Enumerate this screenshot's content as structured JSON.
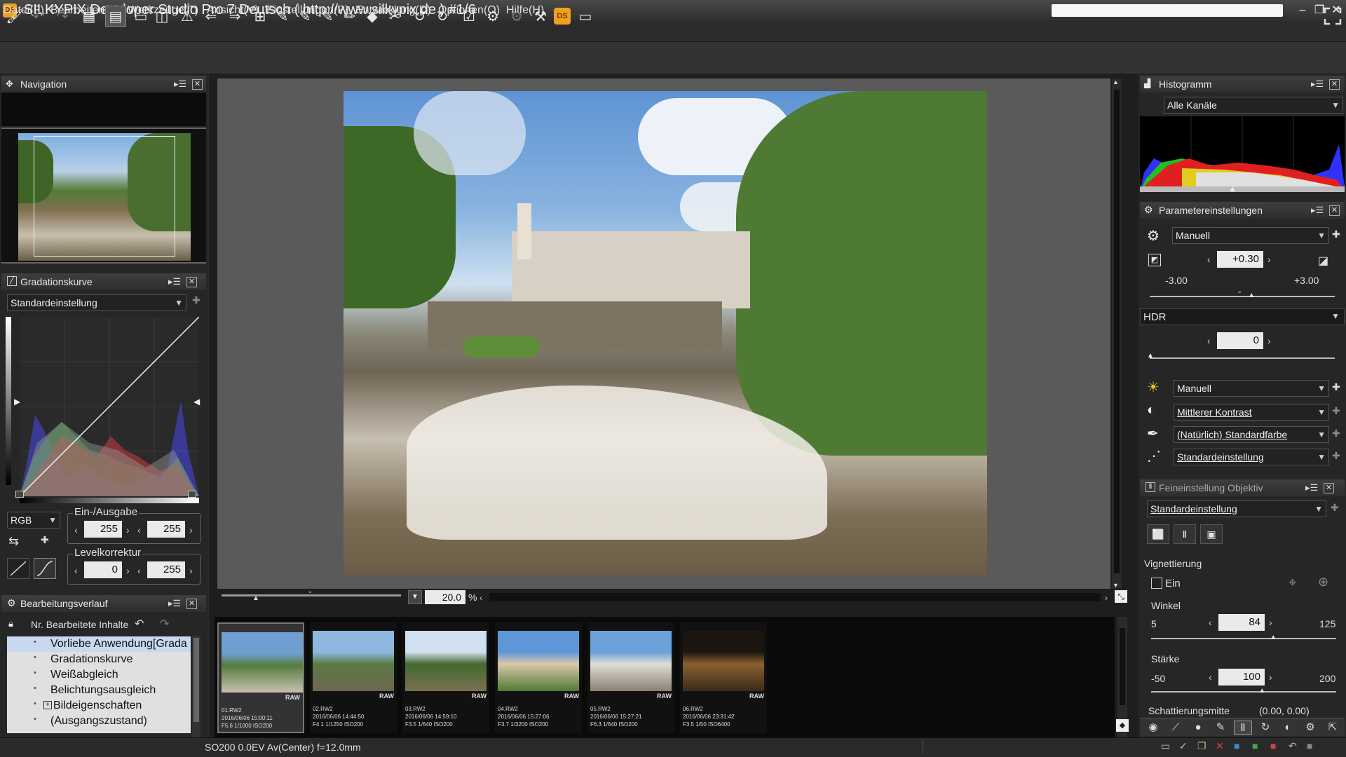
{
  "window": {
    "title": "SILKYPIX Developer Studio Pro 7 Deutsch ( http://www.silkypix.de )   #1/6",
    "icon_label": "DS"
  },
  "menu": [
    "Datei(F)",
    "Bearbeiten(E)",
    "Werkzeuge(T)",
    "Ansicht(V)",
    "Einstellungen(P)",
    "Entwicklung(D)",
    "Optionen(O)",
    "Hilfe(H)"
  ],
  "navigation": {
    "title": "Navigation"
  },
  "curve": {
    "title": "Gradationskurve",
    "preset": "Standardeinstellung",
    "channel": "RGB",
    "io_label": "Ein-/Ausgabe",
    "io_in": "255",
    "io_out": "255",
    "level_label": "Levelkorrektur",
    "level_min": "0",
    "level_max": "255"
  },
  "history": {
    "title": "Bearbeitungsverlauf",
    "header": "Nr. Bearbeitete Inhalte",
    "items": [
      "Vorliebe Anwendung[Grada",
      "Gradationskurve",
      "Weißabgleich",
      "Belichtungsausgleich",
      "Bildeigenschaften",
      "(Ausgangszustand)"
    ]
  },
  "viewer": {
    "zoom": "20.0",
    "zoom_unit": "%"
  },
  "thumbnails": [
    {
      "name": "01.RW2",
      "date": "2016/06/06 15:00:11",
      "exif": "F5.6 1/1000 ISO200",
      "badge": "RAW",
      "colors": [
        "#6f9fd0",
        "#567c3c",
        "#c8c0b0"
      ]
    },
    {
      "name": "02.RW2",
      "date": "2016/06/06 14:44:50",
      "exif": "F4.1 1/1250 ISO200",
      "badge": "RAW",
      "colors": [
        "#8fb8e0",
        "#5a7a44",
        "#6e6650"
      ]
    },
    {
      "name": "03.RW2",
      "date": "2016/06/06 14:59:10",
      "exif": "F3.5 1/640 ISO200",
      "badge": "RAW",
      "colors": [
        "#d0e0f0",
        "#44692e",
        "#7a7052"
      ]
    },
    {
      "name": "04.RW2",
      "date": "2016/06/06 15:27:06",
      "exif": "F3.7 1/3200 ISO200",
      "badge": "RAW",
      "colors": [
        "#5f96d8",
        "#d8c8a8",
        "#4e7a34"
      ]
    },
    {
      "name": "05.RW2",
      "date": "2016/06/06 15:27:21",
      "exif": "F6.3 1/640 ISO200",
      "badge": "RAW",
      "colors": [
        "#6ba0d8",
        "#e0ded8",
        "#8a8070"
      ]
    },
    {
      "name": "06.RW2",
      "date": "2016/06/06 23:31:42",
      "exif": "F3.5 1/50 ISO6400",
      "badge": "RAW",
      "colors": [
        "#1c1610",
        "#8a6030",
        "#3a2a18"
      ]
    }
  ],
  "status": {
    "text": "SO200  0.0EV Av(Center) f=12.0mm"
  },
  "histogram": {
    "title": "Histogramm",
    "channel": "Alle Kanäle"
  },
  "params": {
    "title": "Parametereinstellungen",
    "preset": "Manuell",
    "exposure": "+0.30",
    "exposure_min": "-3.00",
    "exposure_max": "+3.00",
    "exposure_level": 0.55,
    "hdr_label": "HDR",
    "hdr_value": "0",
    "wb": "Manuell",
    "contrast": "Mittlerer Kontrast",
    "color": "(Natürlich) Standardfarbe",
    "sharpness": "Standardeinstellung"
  },
  "lens": {
    "title": "Feineinstellung Objektiv",
    "preset": "Standardeinstellung",
    "vignette_label": "Vignettierung",
    "enable_label": "Ein",
    "angle_label": "Winkel",
    "angle_min": "5",
    "angle_value": "84",
    "angle_max": "125",
    "angle_level": 0.66,
    "strength_label": "Stärke",
    "strength_min": "-50",
    "strength_value": "100",
    "strength_max": "200",
    "strength_level": 0.6,
    "center_label": "Schattierungsmitte",
    "center_value": "(0.00, 0.00)"
  },
  "colors": {
    "accent": "#f0a020",
    "selection": "#c8d8f0"
  }
}
